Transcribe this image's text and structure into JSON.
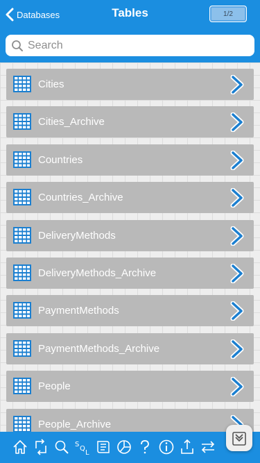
{
  "header": {
    "back_label": "Databases",
    "title": "Tables",
    "page_indicator": "1/2"
  },
  "search": {
    "placeholder": "Search",
    "value": ""
  },
  "tables": [
    "Cities",
    "Cities_Archive",
    "Countries",
    "Countries_Archive",
    "DeliveryMethods",
    "DeliveryMethods_Archive",
    "PaymentMethods",
    "PaymentMethods_Archive",
    "People",
    "People_Archive"
  ],
  "toolbar_icons": [
    "home-icon",
    "refresh-icon",
    "search-icon",
    "sql-icon",
    "scroll-icon",
    "chart-icon",
    "help-icon",
    "info-icon",
    "export-icon",
    "swap-icon"
  ],
  "colors": {
    "accent": "#1b8ee0",
    "row_bg": "#b9b9b9",
    "chevron": "#1b7fd0"
  }
}
